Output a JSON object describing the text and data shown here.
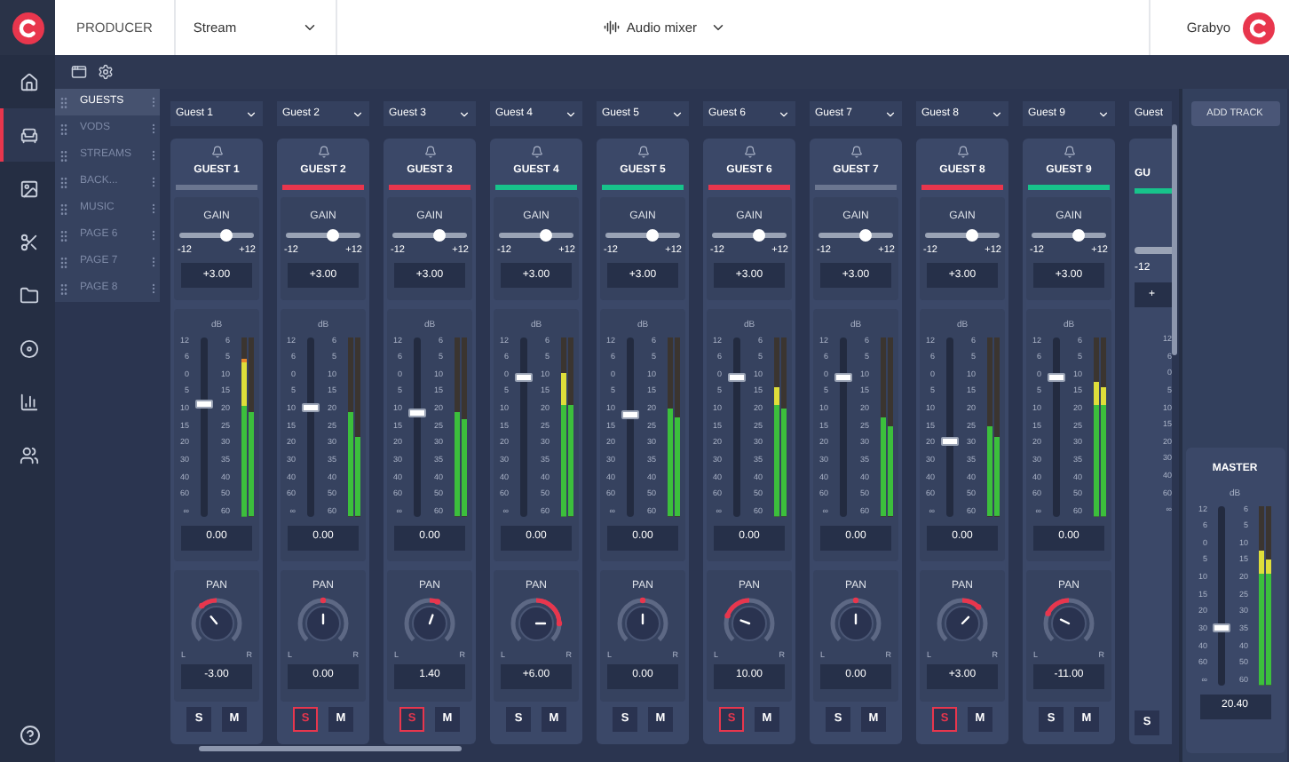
{
  "top_bar": {
    "role": "PRODUCER",
    "stream": "Stream",
    "view": "Audio mixer",
    "user": "Grabyo"
  },
  "nav": [
    {
      "kind": "home",
      "selected": false
    },
    {
      "kind": "chair",
      "selected": true
    },
    {
      "kind": "image",
      "selected": false
    },
    {
      "kind": "scissors",
      "selected": false
    },
    {
      "kind": "folder",
      "selected": false
    },
    {
      "kind": "disc",
      "selected": false
    },
    {
      "kind": "chart",
      "selected": false
    },
    {
      "kind": "group",
      "selected": false
    },
    {
      "kind": "help",
      "selected": false
    }
  ],
  "pages": [
    {
      "label": "GUESTS",
      "selected": true
    },
    {
      "label": "VODS",
      "selected": false
    },
    {
      "label": "STREAMS",
      "selected": false
    },
    {
      "label": "BACK...",
      "selected": false
    },
    {
      "label": "MUSIC",
      "selected": false
    },
    {
      "label": "PAGE 6",
      "selected": false
    },
    {
      "label": "PAGE 7",
      "selected": false
    },
    {
      "label": "PAGE 8",
      "selected": false
    }
  ],
  "channels": [
    {
      "kind": "full",
      "dropdown": "Guest 1",
      "name": "GUEST 1",
      "color": "#6b7690",
      "gain": {
        "label": "GAIN",
        "level": 0.63,
        "min": "-12",
        "max": "+12",
        "value": "+3.00"
      },
      "fader": {
        "label": "dB",
        "scale": [
          "12",
          "6",
          "0",
          "5",
          "10",
          "15",
          "20",
          "30",
          "40",
          "60",
          "∞"
        ],
        "level": 0.62,
        "value": "0.00"
      },
      "meter": {
        "scale": [
          "6",
          "5",
          "10",
          "15",
          "20",
          "25",
          "30",
          "35",
          "40",
          "50",
          "60"
        ],
        "bars": [
          {
            "level": 0.88
          },
          {
            "level": 0.58
          }
        ]
      },
      "pan": {
        "label": "PAN",
        "level": 0.18,
        "left": "L",
        "right": "R",
        "value": "-3.00"
      },
      "solo": {
        "label": "S",
        "on": false
      },
      "mute": {
        "label": "M",
        "on": false
      }
    },
    {
      "kind": "full",
      "dropdown": "Guest 2",
      "name": "GUEST 2",
      "color": "#e8364d",
      "gain": {
        "label": "GAIN",
        "level": 0.63,
        "min": "-12",
        "max": "+12",
        "value": "+3.00"
      },
      "fader": {
        "label": "dB",
        "scale": [
          "12",
          "6",
          "0",
          "5",
          "10",
          "15",
          "20",
          "30",
          "40",
          "60",
          "∞"
        ],
        "level": 0.6,
        "value": "0.00"
      },
      "meter": {
        "scale": [
          "6",
          "5",
          "10",
          "15",
          "20",
          "25",
          "30",
          "35",
          "40",
          "50",
          "60"
        ],
        "bars": [
          {
            "level": 0.58
          },
          {
            "level": 0.44
          }
        ]
      },
      "pan": {
        "label": "PAN",
        "level": 0.5,
        "left": "L",
        "right": "R",
        "value": "0.00"
      },
      "solo": {
        "label": "S",
        "on": true
      },
      "mute": {
        "label": "M",
        "on": false
      }
    },
    {
      "kind": "full",
      "dropdown": "Guest 3",
      "name": "GUEST 3",
      "color": "#e8364d",
      "gain": {
        "label": "GAIN",
        "level": 0.63,
        "min": "-12",
        "max": "+12",
        "value": "+3.00"
      },
      "fader": {
        "label": "dB",
        "scale": [
          "12",
          "6",
          "0",
          "5",
          "10",
          "15",
          "20",
          "30",
          "40",
          "60",
          "∞"
        ],
        "level": 0.57,
        "value": "0.00"
      },
      "meter": {
        "scale": [
          "6",
          "5",
          "10",
          "15",
          "20",
          "25",
          "30",
          "35",
          "40",
          "50",
          "60"
        ],
        "bars": [
          {
            "level": 0.58
          },
          {
            "level": 0.54
          }
        ]
      },
      "pan": {
        "label": "PAN",
        "level": 0.67,
        "left": "L",
        "right": "R",
        "value": "1.40"
      },
      "solo": {
        "label": "S",
        "on": true
      },
      "mute": {
        "label": "M",
        "on": false
      }
    },
    {
      "kind": "full",
      "dropdown": "Guest 4",
      "name": "GUEST 4",
      "color": "#17c38b",
      "gain": {
        "label": "GAIN",
        "level": 0.63,
        "min": "-12",
        "max": "+12",
        "value": "+3.00"
      },
      "fader": {
        "label": "dB",
        "scale": [
          "12",
          "6",
          "0",
          "5",
          "10",
          "15",
          "20",
          "30",
          "40",
          "60",
          "∞"
        ],
        "level": 0.77,
        "value": "0.00"
      },
      "meter": {
        "scale": [
          "6",
          "5",
          "10",
          "15",
          "20",
          "25",
          "30",
          "35",
          "40",
          "50",
          "60"
        ],
        "bars": [
          {
            "level": 0.8
          },
          {
            "level": 0.62
          }
        ]
      },
      "pan": {
        "label": "PAN",
        "level": 1,
        "left": "L",
        "right": "R",
        "value": "+6.00"
      },
      "solo": {
        "label": "S",
        "on": false
      },
      "mute": {
        "label": "M",
        "on": false
      }
    },
    {
      "kind": "full",
      "dropdown": "Guest 5",
      "name": "GUEST 5",
      "color": "#17c38b",
      "gain": {
        "label": "GAIN",
        "level": 0.63,
        "min": "-12",
        "max": "+12",
        "value": "+3.00"
      },
      "fader": {
        "label": "dB",
        "scale": [
          "12",
          "6",
          "0",
          "5",
          "10",
          "15",
          "20",
          "30",
          "40",
          "60",
          "∞"
        ],
        "level": 0.56,
        "value": "0.00"
      },
      "meter": {
        "scale": [
          "6",
          "5",
          "10",
          "15",
          "20",
          "25",
          "30",
          "35",
          "40",
          "50",
          "60"
        ],
        "bars": [
          {
            "level": 0.6
          },
          {
            "level": 0.55
          }
        ]
      },
      "pan": {
        "label": "PAN",
        "level": 0.5,
        "left": "L",
        "right": "R",
        "value": "0.00"
      },
      "solo": {
        "label": "S",
        "on": false
      },
      "mute": {
        "label": "M",
        "on": false
      }
    },
    {
      "kind": "full",
      "dropdown": "Guest 6",
      "name": "GUEST 6",
      "color": "#e8364d",
      "gain": {
        "label": "GAIN",
        "level": 0.63,
        "min": "-12",
        "max": "+12",
        "value": "+3.00"
      },
      "fader": {
        "label": "dB",
        "scale": [
          "12",
          "6",
          "0",
          "5",
          "10",
          "15",
          "20",
          "30",
          "40",
          "60",
          "∞"
        ],
        "level": 0.77,
        "value": "0.00"
      },
      "meter": {
        "scale": [
          "6",
          "5",
          "10",
          "15",
          "20",
          "25",
          "30",
          "35",
          "40",
          "50",
          "60"
        ],
        "bars": [
          {
            "level": 0.72
          },
          {
            "level": 0.6
          }
        ]
      },
      "pan": {
        "label": "PAN",
        "level": 0.03,
        "left": "L",
        "right": "R",
        "value": "10.00"
      },
      "solo": {
        "label": "S",
        "on": true
      },
      "mute": {
        "label": "M",
        "on": false
      }
    },
    {
      "kind": "full",
      "dropdown": "Guest 7",
      "name": "GUEST 7",
      "color": "#6b7690",
      "gain": {
        "label": "GAIN",
        "level": 0.63,
        "min": "-12",
        "max": "+12",
        "value": "+3.00"
      },
      "fader": {
        "label": "dB",
        "scale": [
          "12",
          "6",
          "0",
          "5",
          "10",
          "15",
          "20",
          "30",
          "40",
          "60",
          "∞"
        ],
        "level": 0.77,
        "value": "0.00"
      },
      "meter": {
        "scale": [
          "6",
          "5",
          "10",
          "15",
          "20",
          "25",
          "30",
          "35",
          "40",
          "50",
          "60"
        ],
        "bars": [
          {
            "level": 0.55
          },
          {
            "level": 0.5
          }
        ]
      },
      "pan": {
        "label": "PAN",
        "level": 0.5,
        "left": "L",
        "right": "R",
        "value": "0.00"
      },
      "solo": {
        "label": "S",
        "on": false
      },
      "mute": {
        "label": "M",
        "on": false
      }
    },
    {
      "kind": "full",
      "dropdown": "Guest 8",
      "name": "GUEST 8",
      "color": "#e8364d",
      "gain": {
        "label": "GAIN",
        "level": 0.63,
        "min": "-12",
        "max": "+12",
        "value": "+3.00"
      },
      "fader": {
        "label": "dB",
        "scale": [
          "12",
          "6",
          "0",
          "5",
          "10",
          "15",
          "20",
          "30",
          "40",
          "60",
          "∞"
        ],
        "level": 0.42,
        "value": "0.00"
      },
      "meter": {
        "scale": [
          "6",
          "5",
          "10",
          "15",
          "20",
          "25",
          "30",
          "35",
          "40",
          "50",
          "60"
        ],
        "bars": [
          {
            "level": 0.5
          },
          {
            "level": 0.44
          }
        ]
      },
      "pan": {
        "label": "PAN",
        "level": 0.85,
        "left": "L",
        "right": "R",
        "value": "+3.00"
      },
      "solo": {
        "label": "S",
        "on": true
      },
      "mute": {
        "label": "M",
        "on": false
      }
    },
    {
      "kind": "full",
      "dropdown": "Guest 9",
      "name": "GUEST 9",
      "color": "#17c38b",
      "gain": {
        "label": "GAIN",
        "level": 0.63,
        "min": "-12",
        "max": "+12",
        "value": "+3.00"
      },
      "fader": {
        "label": "dB",
        "scale": [
          "12",
          "6",
          "0",
          "5",
          "10",
          "15",
          "20",
          "30",
          "40",
          "60",
          "∞"
        ],
        "level": 0.77,
        "value": "0.00"
      },
      "meter": {
        "scale": [
          "6",
          "5",
          "10",
          "15",
          "20",
          "25",
          "30",
          "35",
          "40",
          "50",
          "60"
        ],
        "bars": [
          {
            "level": 0.75
          },
          {
            "level": 0.72
          }
        ]
      },
      "pan": {
        "label": "PAN",
        "level": 0.05,
        "left": "L",
        "right": "R",
        "value": "-11.00"
      },
      "solo": {
        "label": "S",
        "on": false
      },
      "mute": {
        "label": "M",
        "on": false
      }
    },
    {
      "kind": "partial",
      "dropdown": "Guest",
      "name": "GU",
      "color": "#17c38b",
      "gain": {
        "min": "-12",
        "value": "+"
      },
      "fader": {
        "scale": [
          "12",
          "6",
          "0",
          "5",
          "10",
          "15",
          "20",
          "30",
          "40",
          "60",
          "∞"
        ]
      },
      "solo": {
        "label": "S",
        "on": false
      }
    }
  ],
  "add_track": "ADD TRACK",
  "master": {
    "title": "MASTER",
    "fader": {
      "label": "dB",
      "scale": [
        "12",
        "6",
        "0",
        "5",
        "10",
        "15",
        "20",
        "30",
        "40",
        "60",
        "∞"
      ],
      "level": 0.32,
      "value": "20.40"
    },
    "meter": {
      "scale": [
        "6",
        "5",
        "10",
        "15",
        "20",
        "25",
        "30",
        "35",
        "40",
        "50",
        "60"
      ],
      "bars": [
        {
          "level": 0.75
        },
        {
          "level": 0.7
        }
      ]
    }
  }
}
